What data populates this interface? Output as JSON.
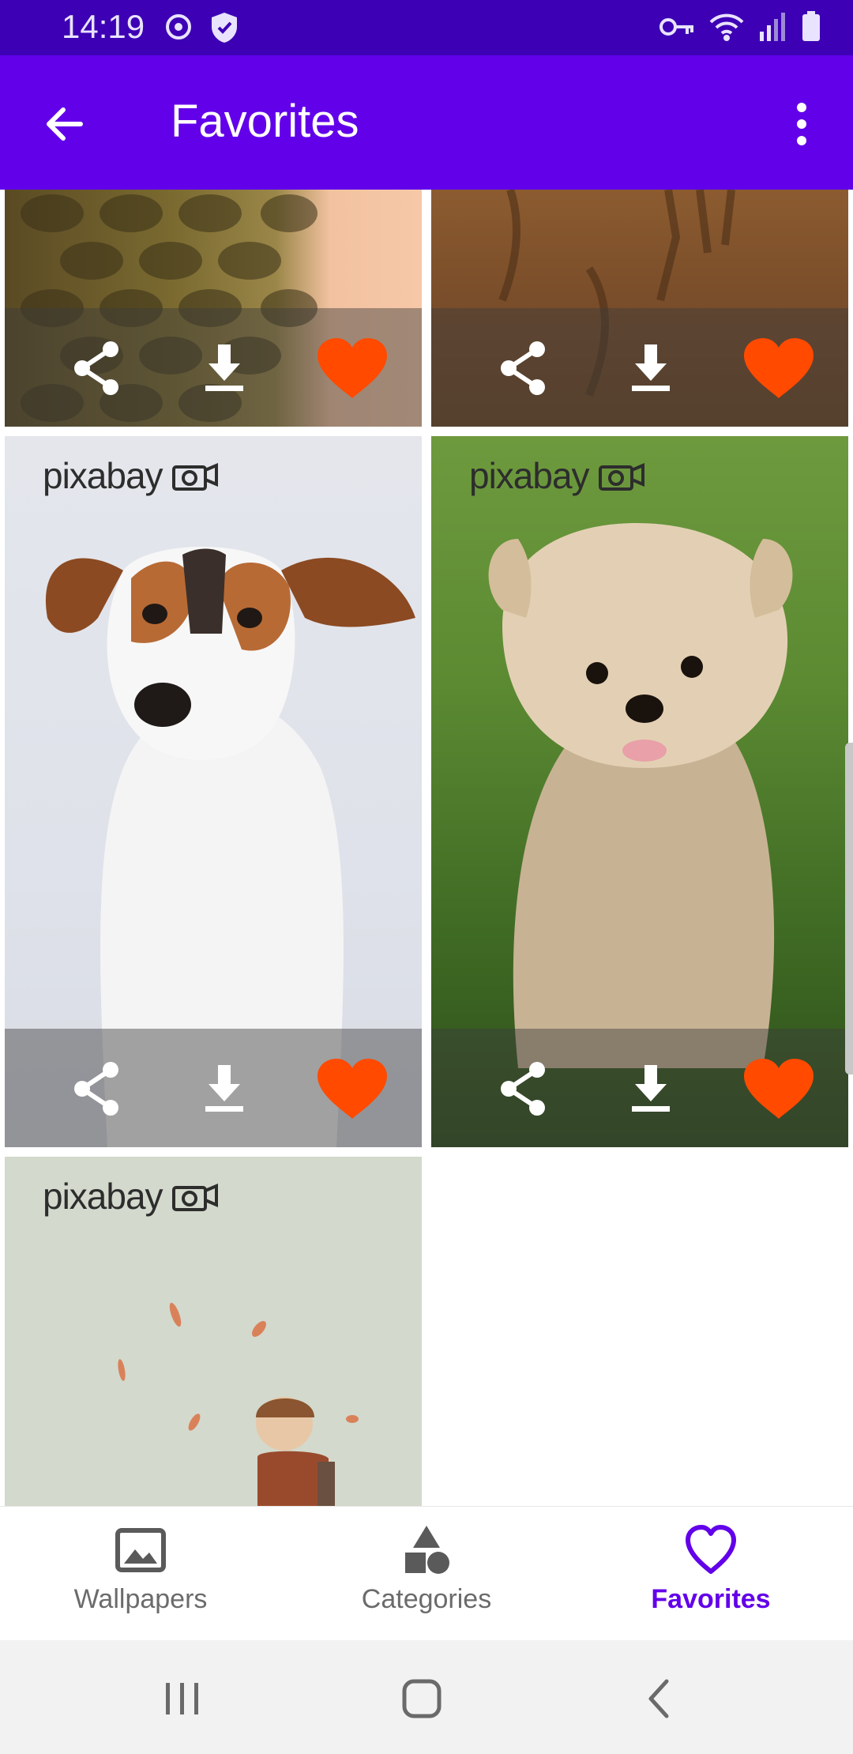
{
  "status_bar": {
    "time": "14:19"
  },
  "app_bar": {
    "title": "Favorites"
  },
  "watermark": "pixabay",
  "bottom_nav": {
    "items": [
      {
        "label": "Wallpapers",
        "icon": "image-icon"
      },
      {
        "label": "Categories",
        "icon": "shapes-icon"
      },
      {
        "label": "Favorites",
        "icon": "heart-outline-icon"
      }
    ],
    "active": "Favorites"
  },
  "colors": {
    "primary": "#6200ea",
    "status": "#3d00b4",
    "heart": "#ff4a00"
  }
}
